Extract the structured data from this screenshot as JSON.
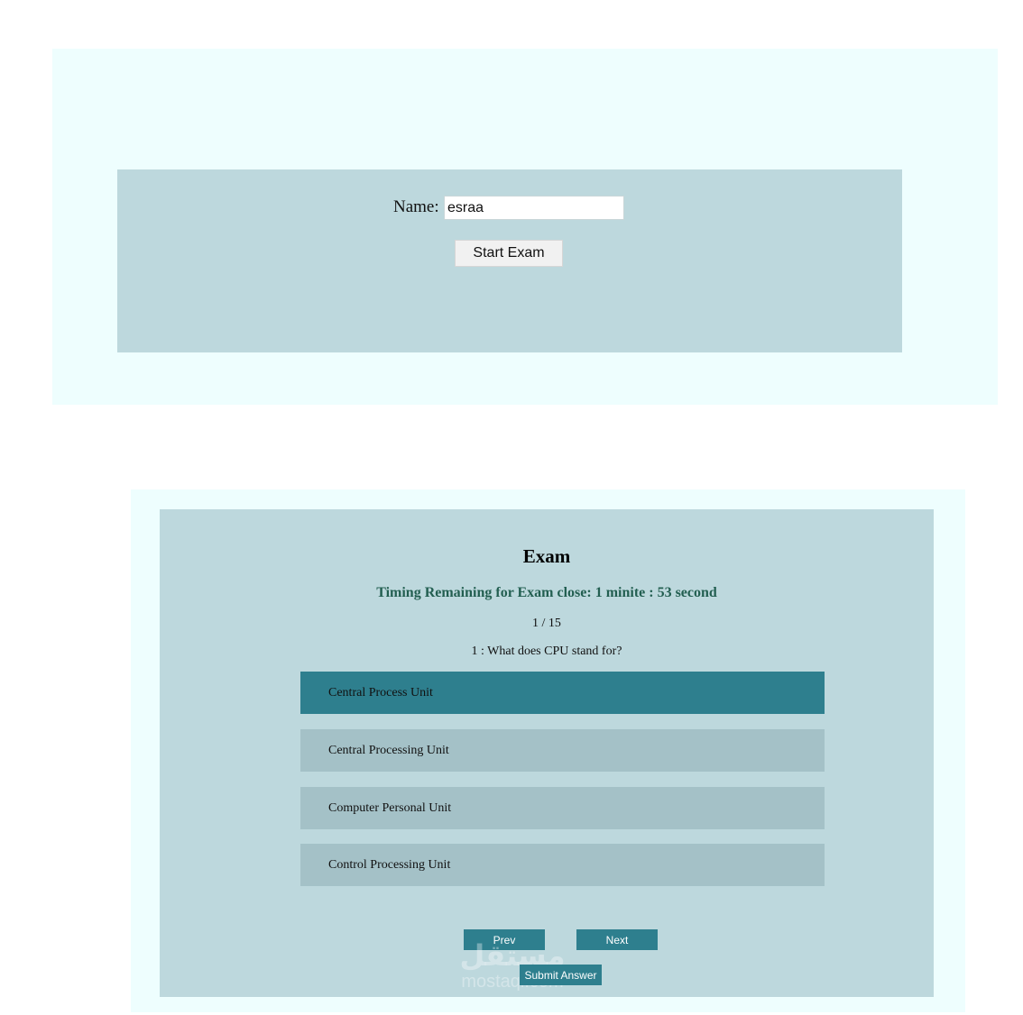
{
  "login": {
    "name_label": "Name:",
    "name_value": "esraa",
    "start_button": "Start Exam"
  },
  "exam": {
    "title": "Exam",
    "timer": "Timing Remaining for Exam close: 1 minite : 53 second",
    "progress": "1 / 15",
    "question": "1 : What does CPU stand for?",
    "answers": [
      {
        "label": "Central Process Unit",
        "selected": true
      },
      {
        "label": "Central Processing Unit",
        "selected": false
      },
      {
        "label": "Computer Personal Unit",
        "selected": false
      },
      {
        "label": "Control Processing Unit",
        "selected": false
      }
    ],
    "prev_button": "Prev",
    "next_button": "Next",
    "submit_button": "Submit Answer"
  },
  "watermark": {
    "arabic": "مستقل",
    "latin": "mostaql.com"
  },
  "colors": {
    "panel_outer": "#eefefe",
    "panel_inner": "#bdd8dd",
    "answer_default": "#a4c1c7",
    "accent": "#2e7f8e",
    "timer_text": "#235f51"
  }
}
